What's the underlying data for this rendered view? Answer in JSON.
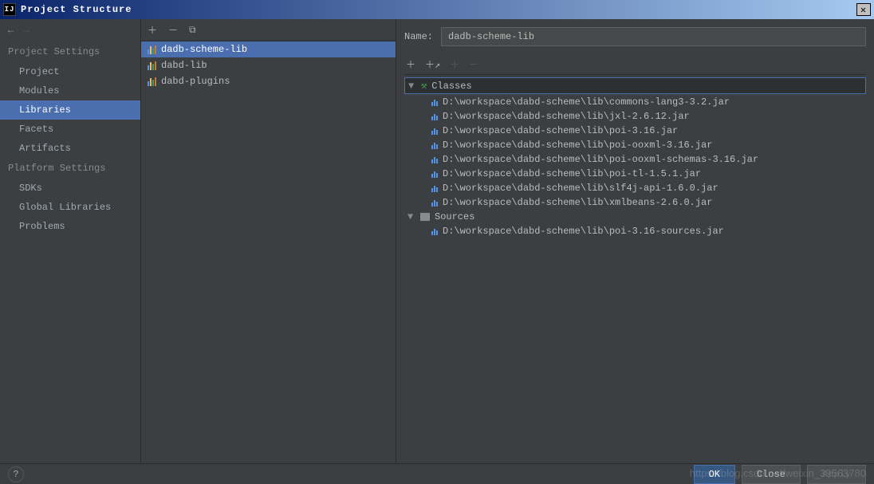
{
  "window": {
    "title": "Project Structure"
  },
  "sidebar": {
    "sections": [
      {
        "heading": "Project Settings",
        "items": [
          "Project",
          "Modules",
          "Libraries",
          "Facets",
          "Artifacts"
        ]
      },
      {
        "heading": "Platform Settings",
        "items": [
          "SDKs",
          "Global Libraries"
        ]
      },
      {
        "heading": "",
        "items": [
          "Problems"
        ]
      }
    ],
    "selected": "Libraries"
  },
  "libraries": {
    "items": [
      "dadb-scheme-lib",
      "dabd-lib",
      "dabd-plugins"
    ],
    "selected": "dadb-scheme-lib"
  },
  "detail": {
    "name_label": "Name:",
    "name_value": "dadb-scheme-lib",
    "groups": [
      {
        "label": "Classes",
        "icon": "hammer",
        "files": [
          "D:\\workspace\\dabd-scheme\\lib\\commons-lang3-3.2.jar",
          "D:\\workspace\\dabd-scheme\\lib\\jxl-2.6.12.jar",
          "D:\\workspace\\dabd-scheme\\lib\\poi-3.16.jar",
          "D:\\workspace\\dabd-scheme\\lib\\poi-ooxml-3.16.jar",
          "D:\\workspace\\dabd-scheme\\lib\\poi-ooxml-schemas-3.16.jar",
          "D:\\workspace\\dabd-scheme\\lib\\poi-tl-1.5.1.jar",
          "D:\\workspace\\dabd-scheme\\lib\\slf4j-api-1.6.0.jar",
          "D:\\workspace\\dabd-scheme\\lib\\xmlbeans-2.6.0.jar"
        ]
      },
      {
        "label": "Sources",
        "icon": "folder",
        "files": [
          "D:\\workspace\\dabd-scheme\\lib\\poi-3.16-sources.jar"
        ]
      }
    ]
  },
  "footer": {
    "ok": "OK",
    "cancel": "Close",
    "apply": "Apply"
  },
  "watermark": "https://blog.csdn.net/weixin_39563780"
}
